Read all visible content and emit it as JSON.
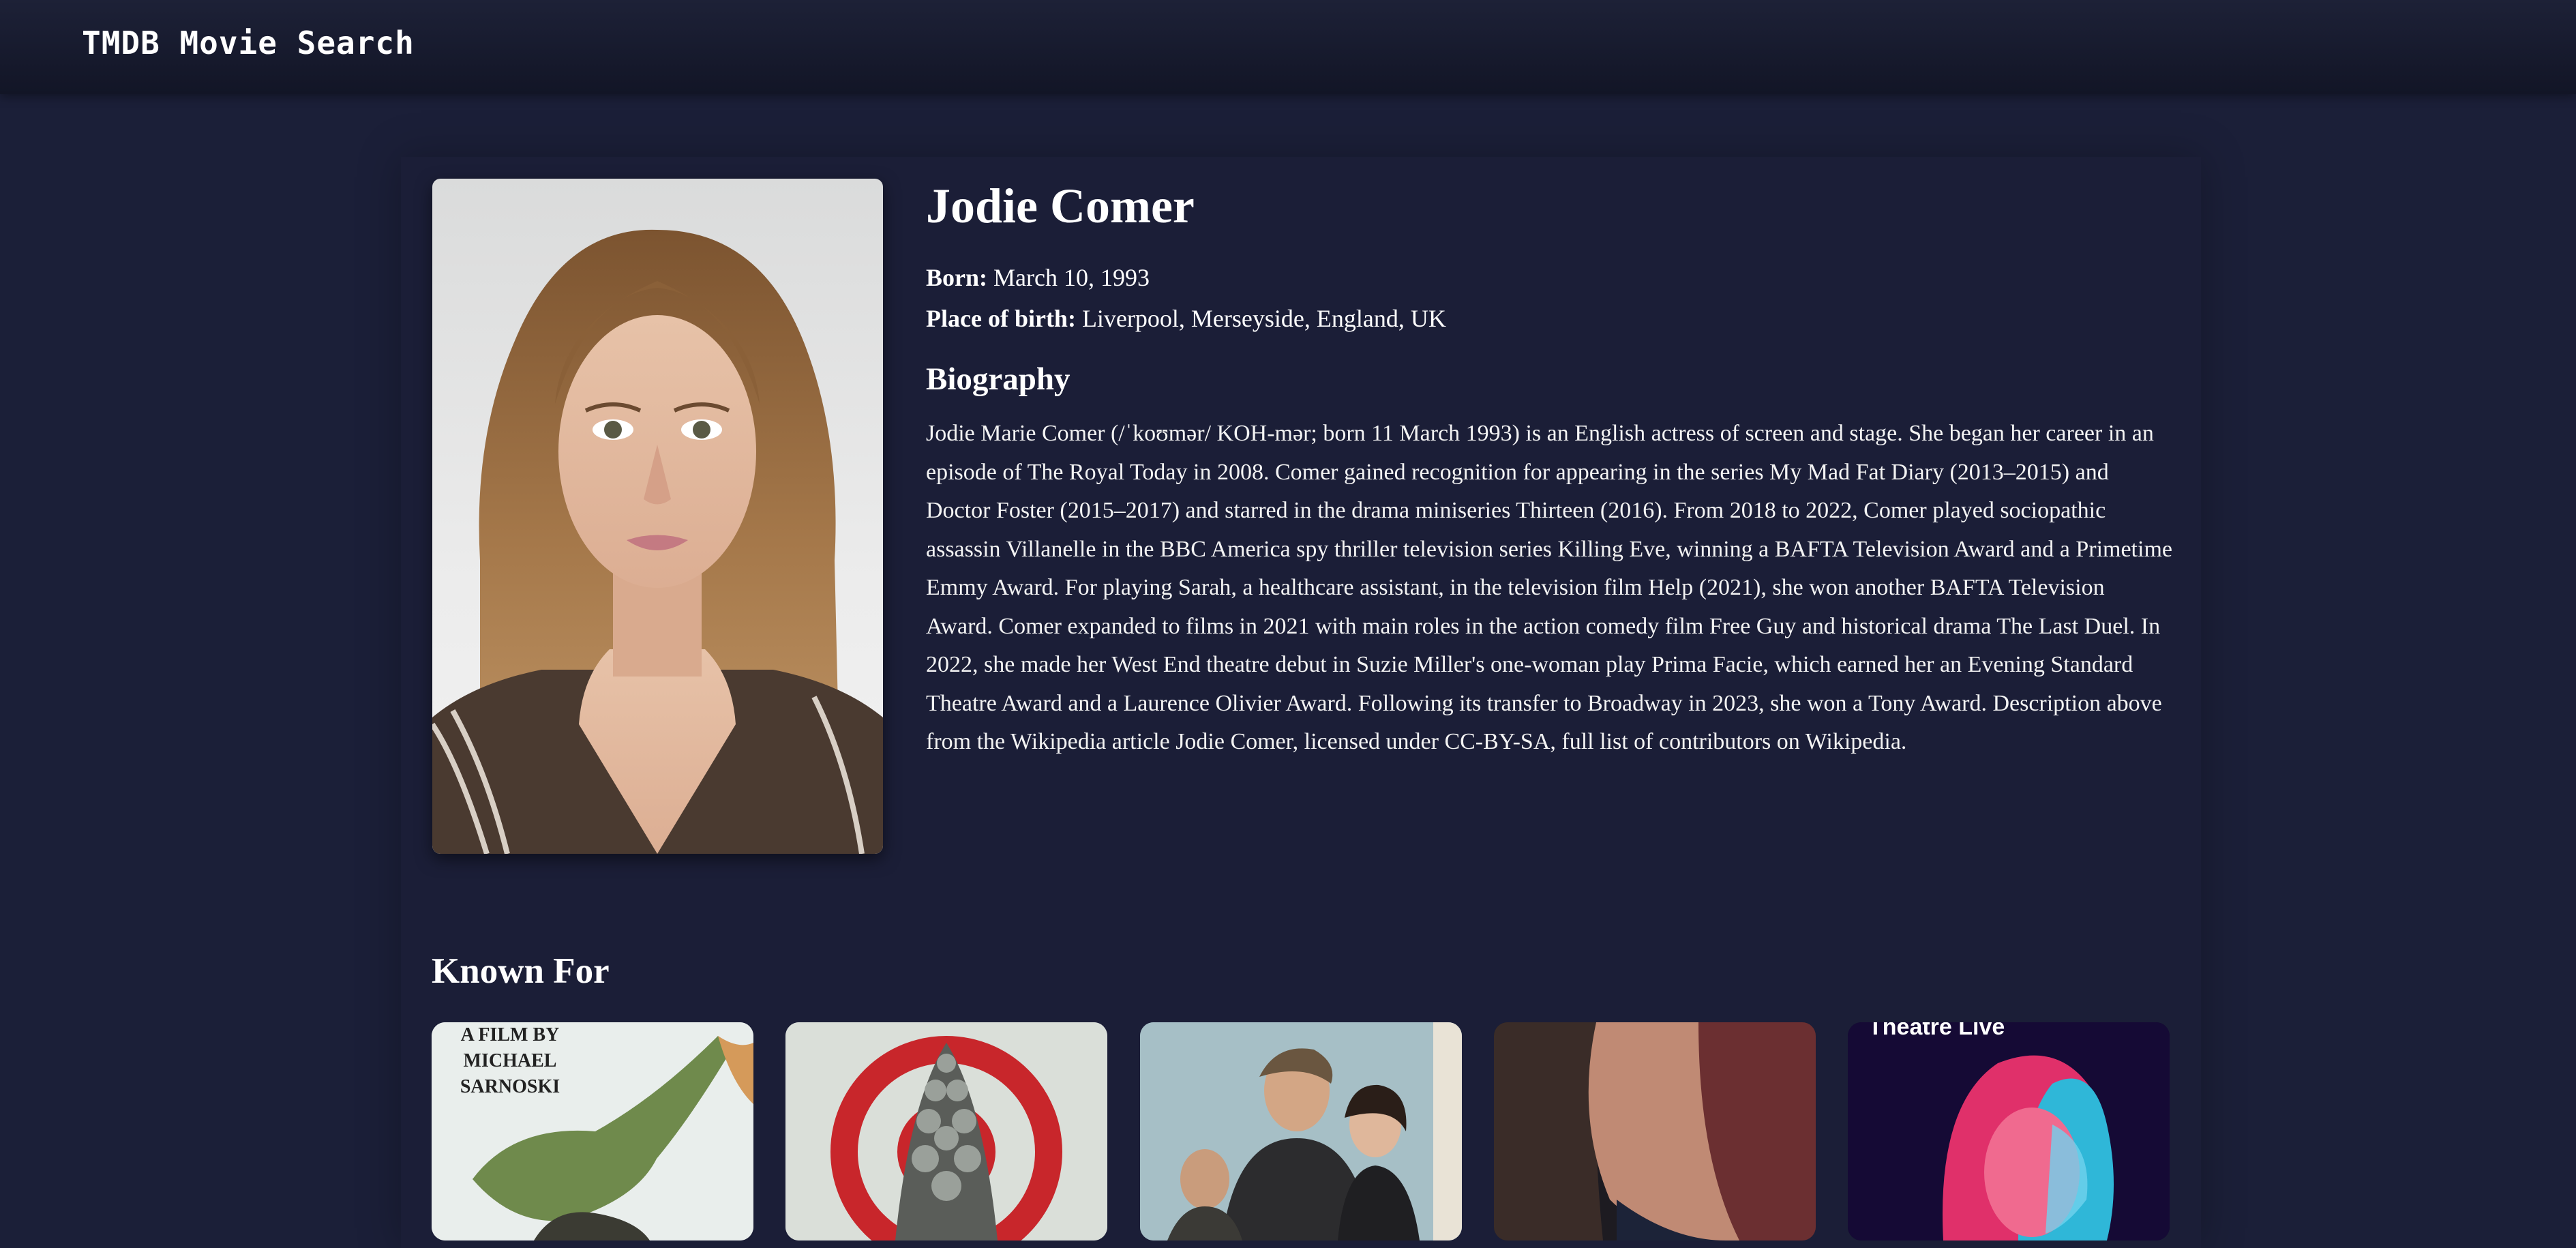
{
  "header": {
    "title": "TMDB Movie Search"
  },
  "person": {
    "name": "Jodie Comer",
    "born_label": "Born:",
    "born_value": "March 10, 1993",
    "birthplace_label": "Place of birth:",
    "birthplace_value": "Liverpool, Merseyside, England, UK",
    "biography_heading": "Biography",
    "biography": "Jodie Marie Comer (/ˈkoʊmər/ KOH-mər; born 11 March 1993) is an English actress of screen and stage. She began her career in an episode of The Royal Today in 2008. Comer gained recognition for appearing in the series My Mad Fat Diary (2013–2015) and Doctor Foster (2015–2017) and starred in the drama miniseries Thirteen (2016). From 2018 to 2022, Comer played sociopathic assassin Villanelle in the BBC America spy thriller television series Killing Eve, winning a BAFTA Television Award and a Primetime Emmy Award. For playing Sarah, a healthcare assistant, in the television film Help (2021), she won another BAFTA Television Award. Comer expanded to films in 2021 with main roles in the action comedy film Free Guy and historical drama The Last Duel. In 2022, she made her West End theatre debut in Suzie Miller's one-woman play Prima Facie, which earned her an Evening Standard Theatre Award and a Laurence Olivier Award. Following its transfer to Broadway in 2023, she won a Tony Award. Description above from the Wikipedia article Jodie Comer, licensed under CC-BY-SA, full list of contributors on Wikipedia."
  },
  "known_for": {
    "heading": "Known For",
    "posters": [
      {
        "text": "A FILM BY MICHAEL SARNOSKI"
      },
      {
        "text": ""
      },
      {
        "text": ""
      },
      {
        "text": ""
      },
      {
        "text": "Theatre Live"
      }
    ]
  },
  "colors": {
    "background": "#1b1f38",
    "header": "#141729",
    "text": "#ffffff"
  }
}
